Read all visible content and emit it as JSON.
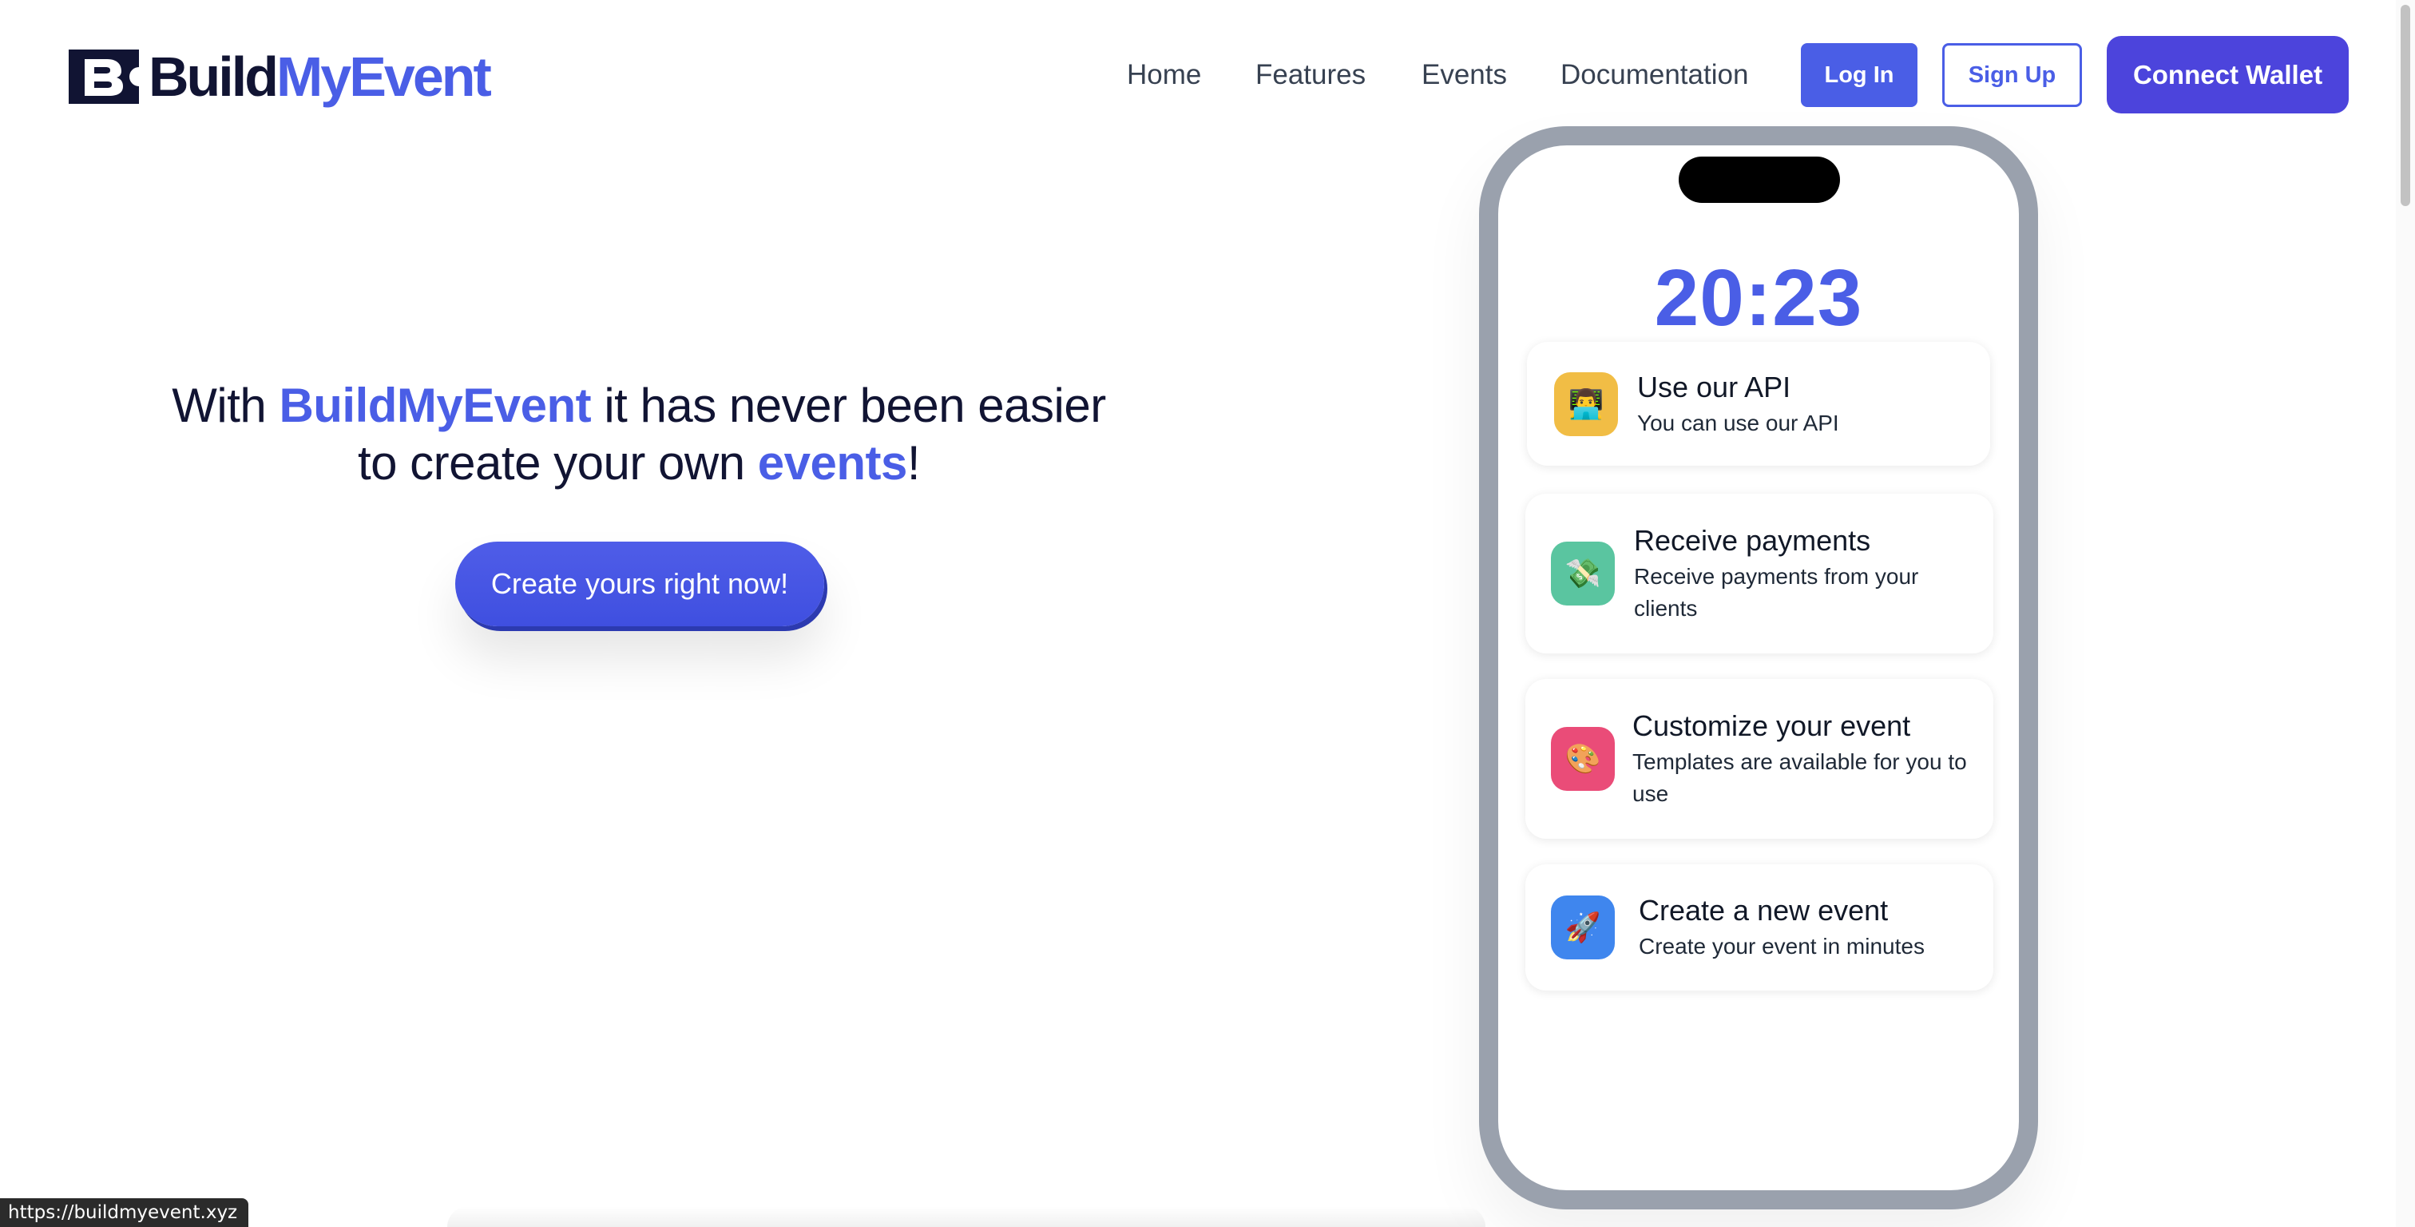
{
  "brand": {
    "name_part1": "Build",
    "name_part2": "MyEvent"
  },
  "nav": {
    "links": [
      "Home",
      "Features",
      "Events",
      "Documentation"
    ],
    "login": "Log In",
    "signup": "Sign Up",
    "connect_wallet": "Connect Wallet"
  },
  "hero": {
    "t1": "With ",
    "t2": "BuildMyEvent",
    "t3": " it has never been easier",
    "t4": "to create your own ",
    "t5": "events",
    "t6": "!",
    "cta": "Create yours right now!"
  },
  "phone": {
    "time": "20:23",
    "cards": [
      {
        "title": "Use our API",
        "desc": "You can use our API",
        "icon": "technologist-emoji",
        "color": "#f1bd45",
        "glyph": "👨‍💻"
      },
      {
        "title": "Receive payments",
        "desc": "Receive payments from your clients",
        "icon": "money-emoji",
        "color": "#5ac5a0",
        "glyph": "💸"
      },
      {
        "title": "Customize your event",
        "desc": "Templates are available for you to use",
        "icon": "palette-emoji",
        "color": "#ea4c78",
        "glyph": "🎨"
      },
      {
        "title": "Create a new event",
        "desc": "Create your event in minutes",
        "icon": "rocket-emoji",
        "color": "#3f86ee",
        "glyph": "🚀"
      }
    ]
  },
  "status_bar": {
    "url": "https://buildmyevent.xyz"
  },
  "colors": {
    "accent": "#4a5ee6",
    "wallet": "#4c44dc",
    "dark": "#111433"
  }
}
